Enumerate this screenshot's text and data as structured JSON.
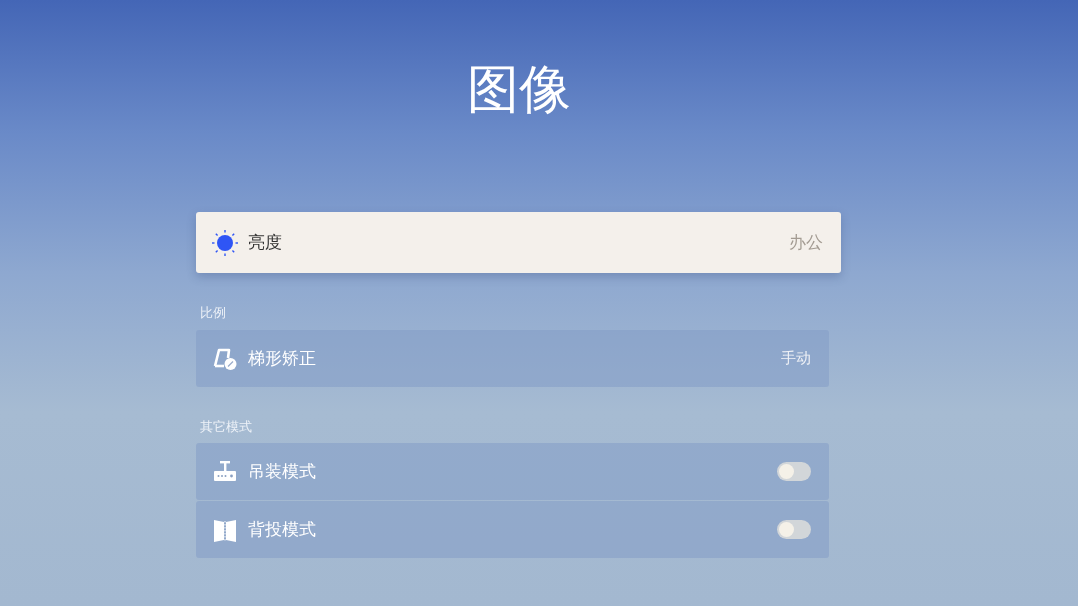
{
  "title": "图像",
  "groups": [
    {
      "items": [
        {
          "kind": "value",
          "label": "亮度",
          "value": "办公",
          "selected": true
        }
      ]
    },
    {
      "heading": "比例",
      "items": [
        {
          "kind": "value",
          "label": "梯形矫正",
          "value": "手动",
          "selected": false
        }
      ]
    },
    {
      "heading": "其它模式",
      "items": [
        {
          "kind": "toggle",
          "label": "吊装模式",
          "on": false,
          "selected": false
        },
        {
          "kind": "toggle",
          "label": "背投模式",
          "on": false,
          "selected": false
        }
      ]
    }
  ]
}
